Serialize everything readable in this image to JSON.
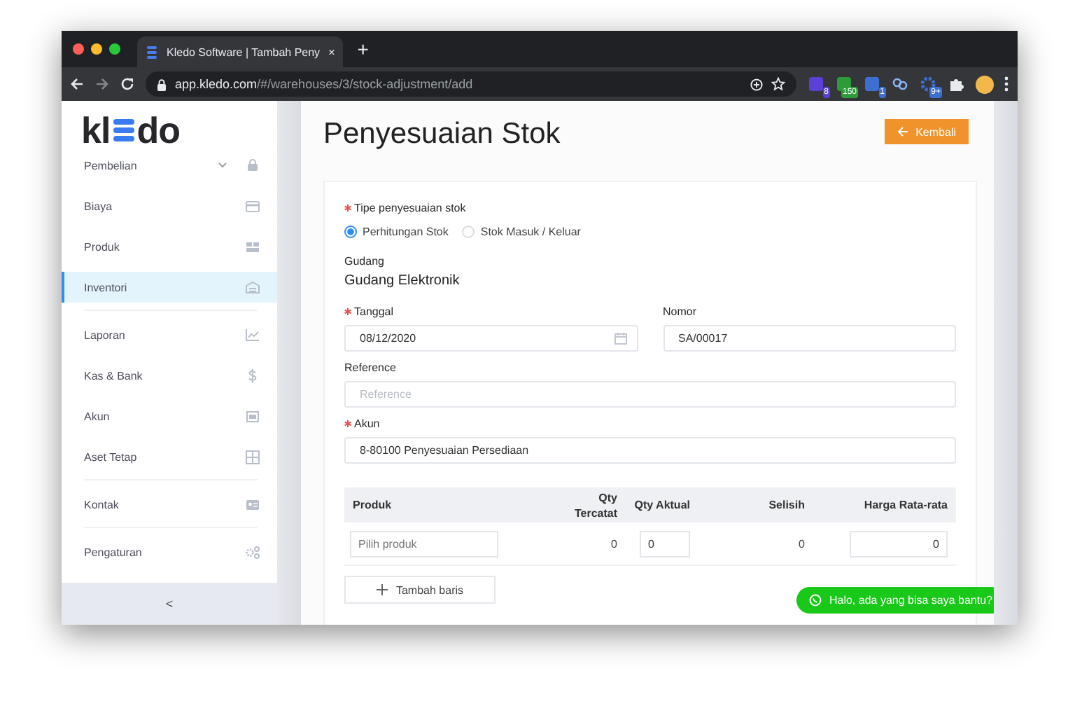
{
  "browser": {
    "tab_title": "Kledo Software | Tambah Peny",
    "tab_close": "×",
    "new_tab": "+",
    "url": "**app.kledo.com**/#/warehouses/3/stock-adjustment/add",
    "extensions": [
      {
        "kind": "box",
        "badge": "8",
        "color": "#5b3fd6"
      },
      {
        "kind": "box",
        "badge": "150",
        "color": "#2e9b3a"
      },
      {
        "kind": "box",
        "badge": "1",
        "color": "#3d6fd1"
      },
      {
        "kind": "link"
      },
      {
        "kind": "gear",
        "badge": "9+",
        "color": "#3d6fd1"
      },
      {
        "kind": "puzzle"
      }
    ]
  },
  "sidebar": {
    "logo": {
      "left": "kl",
      "right": "do"
    },
    "items": [
      {
        "label": "Pembelian",
        "selected": false,
        "expandable": true,
        "divider_after": false
      },
      {
        "label": "Biaya",
        "selected": false,
        "expandable": false,
        "divider_after": false
      },
      {
        "label": "Produk",
        "selected": false,
        "expandable": false,
        "divider_after": false
      },
      {
        "label": "Inventori",
        "selected": true,
        "expandable": false,
        "divider_after": true
      },
      {
        "label": "Laporan",
        "selected": false,
        "expandable": false,
        "divider_after": false
      },
      {
        "label": "Kas & Bank",
        "selected": false,
        "expandable": false,
        "divider_after": false
      },
      {
        "label": "Akun",
        "selected": false,
        "expandable": false,
        "divider_after": false
      },
      {
        "label": "Aset Tetap",
        "selected": false,
        "expandable": false,
        "divider_after": true
      },
      {
        "label": "Kontak",
        "selected": false,
        "expandable": false,
        "divider_after": true
      },
      {
        "label": "Pengaturan",
        "selected": false,
        "expandable": false,
        "divider_after": false
      }
    ],
    "collapse": "<"
  },
  "page": {
    "title": "Penyesuaian Stok",
    "back_button": "Kembali"
  },
  "form": {
    "type_label": {
      "text": "Tipe penyesuaian stok",
      "required": true
    },
    "options": [
      {
        "label": "Perhitungan Stok",
        "selected": true
      },
      {
        "label": "Stok Masuk / Keluar",
        "selected": false
      }
    ],
    "warehouse": {
      "label": "Gudang",
      "value": "Gudang Elektronik"
    },
    "rows": [
      [
        {
          "label": "Tanggal",
          "required": true,
          "kind": "date",
          "value": "08/12/2020"
        },
        {
          "label": "Nomor",
          "required": false,
          "kind": "text",
          "value": "SA/00017"
        }
      ],
      [
        {
          "label": "Reference",
          "required": false,
          "kind": "text",
          "placeholder": "Reference"
        }
      ],
      [
        {
          "label": "Akun",
          "required": true,
          "kind": "text",
          "value": "8-80100 Penyesuaian Persediaan"
        }
      ]
    ]
  },
  "table": {
    "columns": [
      "Produk",
      "Qty Tercatat",
      "Qty Aktual",
      "Selisih",
      "Harga Rata-rata"
    ],
    "rows": [
      [
        {
          "kind": "select",
          "placeholder": "Pilih produk"
        },
        {
          "kind": "text",
          "value": "0"
        },
        {
          "kind": "input",
          "value": "0"
        },
        {
          "kind": "text",
          "value": "0"
        },
        {
          "kind": "input",
          "value": "0"
        }
      ]
    ],
    "add_button": "Tambah baris"
  },
  "chat": {
    "text": "Halo, ada yang bisa saya bantu?"
  }
}
